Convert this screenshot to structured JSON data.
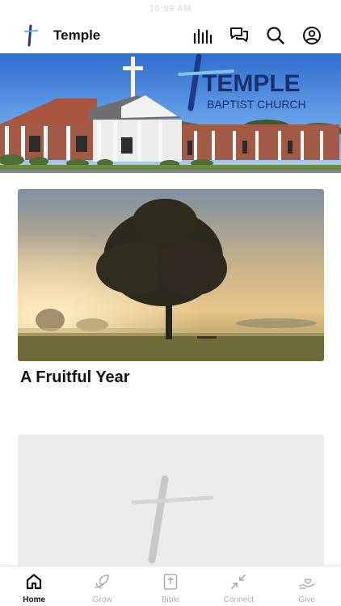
{
  "status_bar": {
    "time": "10:59 AM"
  },
  "header": {
    "title": "Temple",
    "icons": [
      "bars-audio-icon",
      "chat-bubbles-icon",
      "search-icon",
      "profile-icon"
    ]
  },
  "hero": {
    "line1": "TEMPLE",
    "line2": "BAPTIST CHURCH"
  },
  "feature_card": {
    "title": "A Fruitful Year"
  },
  "tabs": [
    {
      "label": "Home",
      "icon": "home-icon",
      "active": true
    },
    {
      "label": "Grow",
      "icon": "leaf-hand-icon",
      "active": false
    },
    {
      "label": "Bible",
      "icon": "bible-icon",
      "active": false
    },
    {
      "label": "Connect",
      "icon": "connect-arrows-icon",
      "active": false
    },
    {
      "label": "Give",
      "icon": "give-heart-icon",
      "active": false
    }
  ],
  "colors": {
    "accent_blue": "#1f3a8a",
    "active_tab": "#111111",
    "inactive_tab": "#b0b0b0"
  }
}
